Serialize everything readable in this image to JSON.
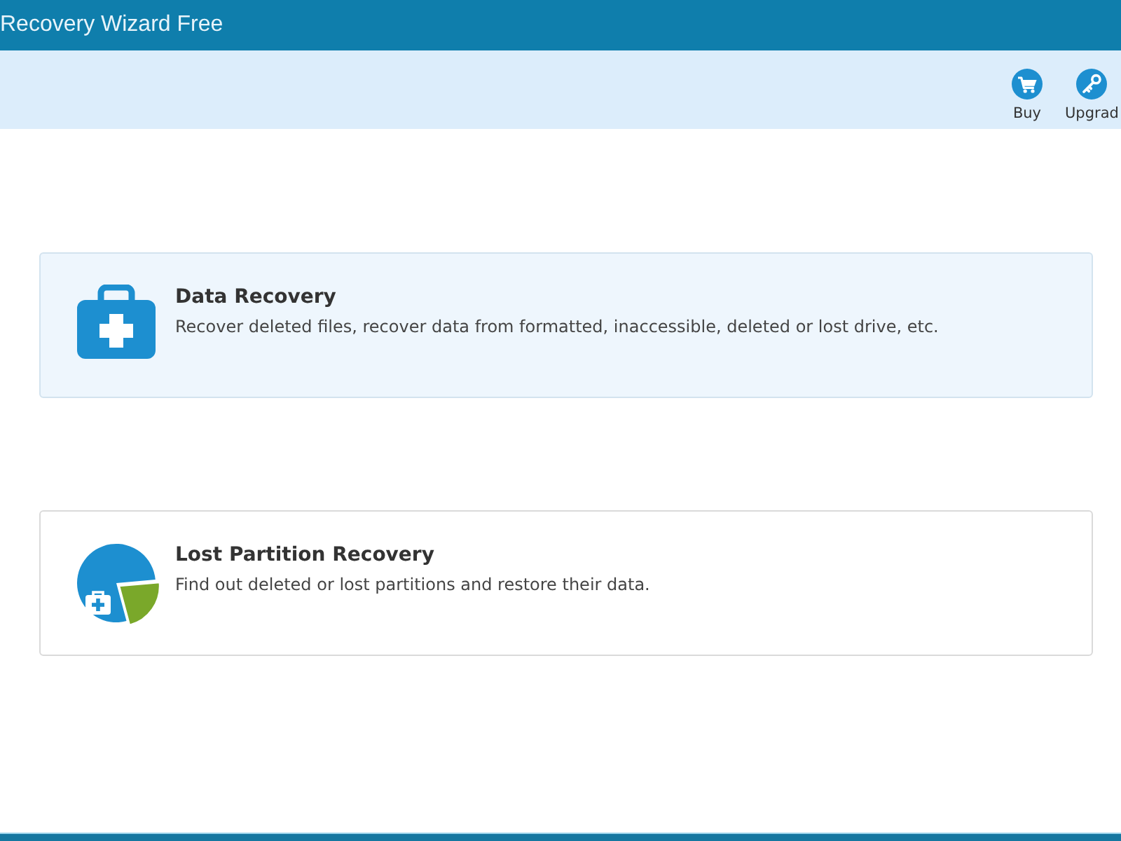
{
  "window": {
    "title": "Recovery Wizard Free"
  },
  "toolbar": {
    "buttons": [
      {
        "kind": "cart",
        "label": "Buy"
      },
      {
        "kind": "key",
        "label": "Upgrad"
      }
    ]
  },
  "options": [
    {
      "kind": "briefcase",
      "title": "Data Recovery",
      "description": "Recover deleted files, recover data from formatted, inaccessible, deleted or lost drive, etc.",
      "selected": true
    },
    {
      "kind": "partition",
      "title": "Lost Partition Recovery",
      "description": "Find out deleted or lost partitions and restore their data.",
      "selected": false
    }
  ]
}
